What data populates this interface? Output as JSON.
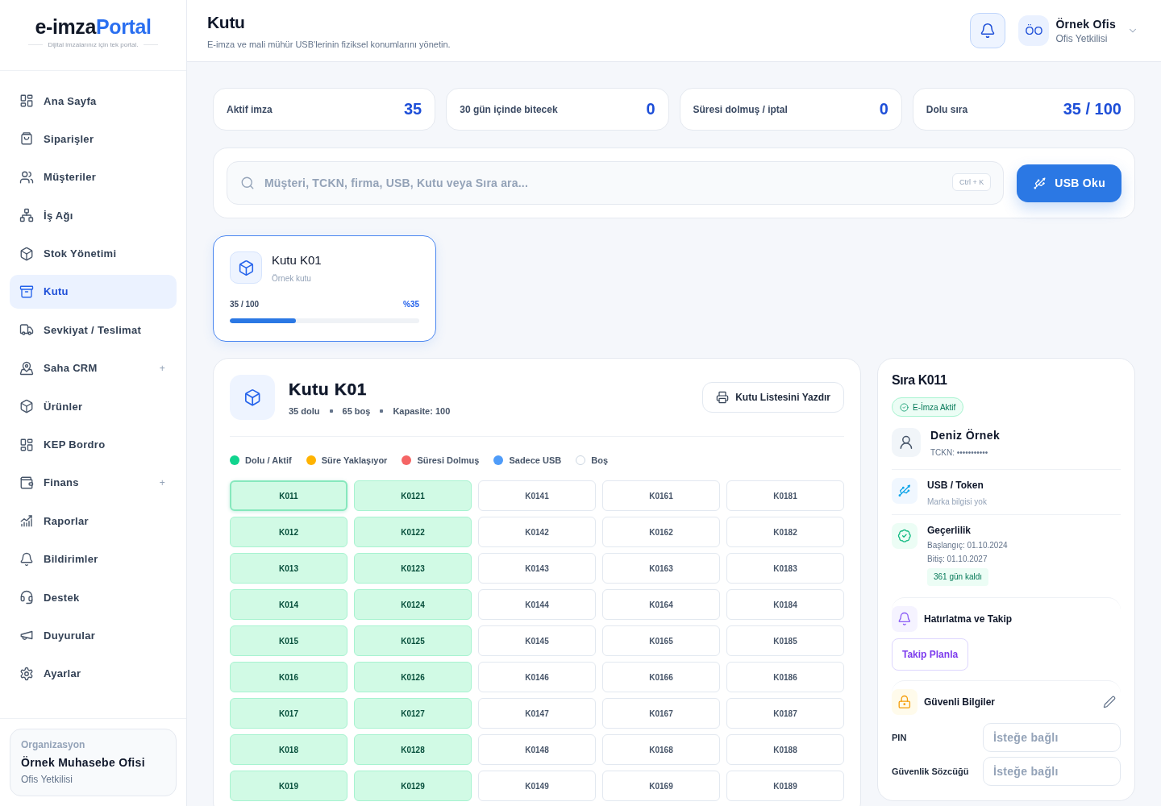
{
  "sidebar": {
    "logo": {
      "text": "e-imza",
      "accent": "Portal",
      "tagline": "Dijital imzalarınız için tek portal."
    },
    "items": [
      {
        "label": "Ana Sayfa",
        "selected": false
      },
      {
        "label": "Siparişler",
        "selected": false
      },
      {
        "label": "Müşteriler",
        "selected": false
      },
      {
        "label": "İş Ağı",
        "selected": false
      },
      {
        "label": "Stok Yönetimi",
        "selected": false
      },
      {
        "label": "Kutu",
        "selected": true
      },
      {
        "label": "Sevkiyat / Teslimat",
        "selected": false
      },
      {
        "label": "Saha CRM",
        "selected": false,
        "toggle": "+"
      },
      {
        "label": "Ürünler",
        "selected": false
      },
      {
        "label": "KEP Bordro",
        "selected": false
      },
      {
        "label": "Finans",
        "selected": false,
        "toggle": "+"
      },
      {
        "label": "Raporlar",
        "selected": false
      },
      {
        "label": "Bildirimler",
        "selected": false
      },
      {
        "label": "Destek",
        "selected": false
      },
      {
        "label": "Duyurular",
        "selected": false
      },
      {
        "label": "Ayarlar",
        "selected": false
      }
    ],
    "organization": {
      "caption": "Organizasyon",
      "name": "Örnek Muhasebe Ofisi",
      "role": "Ofis Yetkilisi"
    }
  },
  "header": {
    "title": "Kutu",
    "subtitle": "E-imza ve mali mühür USB'lerinin fiziksel konumlarını yönetin.",
    "user": {
      "initials": "ÖO",
      "name": "Örnek Ofis",
      "role": "Ofis Yetkilisi"
    }
  },
  "stats": [
    {
      "label": "Aktif imza",
      "value": "35"
    },
    {
      "label": "30 gün içinde bitecek",
      "value": "0"
    },
    {
      "label": "Süresi dolmuş / iptal",
      "value": "0"
    },
    {
      "label": "Dolu sıra",
      "value": "35 / 100"
    }
  ],
  "search": {
    "placeholder": "Müşteri, TCKN, firma, USB, Kutu veya Sıra ara...",
    "shortcut": "Ctrl + K",
    "button": "USB Oku"
  },
  "boxes": [
    {
      "name": "Kutu K01",
      "description": "Örnek kutu",
      "count": "35 / 100",
      "percent": "%35",
      "level": 0.35,
      "selected": true
    }
  ],
  "box_detail": {
    "title": "Kutu K01",
    "meta": [
      "35 dolu",
      "65 boş",
      "Kapasite: 100"
    ],
    "print_button": "Kutu Listesini Yazdır",
    "legend": [
      {
        "label": "Dolu / Aktif",
        "color": "#10d48e"
      },
      {
        "label": "Süre Yaklaşıyor",
        "color": "#ffb300"
      },
      {
        "label": "Süresi Dolmuş",
        "color": "#f56565"
      },
      {
        "label": "Sadece USB",
        "color": "#4f9cf9"
      },
      {
        "label": "Boş",
        "color": "#ffffff"
      }
    ],
    "slots": [
      {
        "label": "K011",
        "kind": "active",
        "selected": true
      },
      {
        "label": "K0121",
        "kind": "active",
        "selected": false
      },
      {
        "label": "K0141",
        "kind": "empty",
        "selected": false
      },
      {
        "label": "K0161",
        "kind": "empty",
        "selected": false
      },
      {
        "label": "K0181",
        "kind": "empty",
        "selected": false
      },
      {
        "label": "K012",
        "kind": "active",
        "selected": false
      },
      {
        "label": "K0122",
        "kind": "active",
        "selected": false
      },
      {
        "label": "K0142",
        "kind": "empty",
        "selected": false
      },
      {
        "label": "K0162",
        "kind": "empty",
        "selected": false
      },
      {
        "label": "K0182",
        "kind": "empty",
        "selected": false
      },
      {
        "label": "K013",
        "kind": "active",
        "selected": false
      },
      {
        "label": "K0123",
        "kind": "active",
        "selected": false
      },
      {
        "label": "K0143",
        "kind": "empty",
        "selected": false
      },
      {
        "label": "K0163",
        "kind": "empty",
        "selected": false
      },
      {
        "label": "K0183",
        "kind": "empty",
        "selected": false
      },
      {
        "label": "K014",
        "kind": "active",
        "selected": false
      },
      {
        "label": "K0124",
        "kind": "active",
        "selected": false
      },
      {
        "label": "K0144",
        "kind": "empty",
        "selected": false
      },
      {
        "label": "K0164",
        "kind": "empty",
        "selected": false
      },
      {
        "label": "K0184",
        "kind": "empty",
        "selected": false
      },
      {
        "label": "K015",
        "kind": "active",
        "selected": false
      },
      {
        "label": "K0125",
        "kind": "active",
        "selected": false
      },
      {
        "label": "K0145",
        "kind": "empty",
        "selected": false
      },
      {
        "label": "K0165",
        "kind": "empty",
        "selected": false
      },
      {
        "label": "K0185",
        "kind": "empty",
        "selected": false
      },
      {
        "label": "K016",
        "kind": "active",
        "selected": false
      },
      {
        "label": "K0126",
        "kind": "active",
        "selected": false
      },
      {
        "label": "K0146",
        "kind": "empty",
        "selected": false
      },
      {
        "label": "K0166",
        "kind": "empty",
        "selected": false
      },
      {
        "label": "K0186",
        "kind": "empty",
        "selected": false
      },
      {
        "label": "K017",
        "kind": "active",
        "selected": false
      },
      {
        "label": "K0127",
        "kind": "active",
        "selected": false
      },
      {
        "label": "K0147",
        "kind": "empty",
        "selected": false
      },
      {
        "label": "K0167",
        "kind": "empty",
        "selected": false
      },
      {
        "label": "K0187",
        "kind": "empty",
        "selected": false
      },
      {
        "label": "K018",
        "kind": "active",
        "selected": false
      },
      {
        "label": "K0128",
        "kind": "active",
        "selected": false
      },
      {
        "label": "K0148",
        "kind": "empty",
        "selected": false
      },
      {
        "label": "K0168",
        "kind": "empty",
        "selected": false
      },
      {
        "label": "K0188",
        "kind": "empty",
        "selected": false
      },
      {
        "label": "K019",
        "kind": "active",
        "selected": false
      },
      {
        "label": "K0129",
        "kind": "active",
        "selected": false
      },
      {
        "label": "K0149",
        "kind": "empty",
        "selected": false
      },
      {
        "label": "K0169",
        "kind": "empty",
        "selected": false
      },
      {
        "label": "K0189",
        "kind": "empty",
        "selected": false
      }
    ]
  },
  "slot_detail": {
    "title": "Sıra K011",
    "badge": "E-İmza Aktif",
    "person": {
      "name": "Deniz Örnek",
      "id_line": "TCKN: •••••••••••"
    },
    "usb": {
      "title": "USB / Token",
      "note": "Marka bilgisi yok"
    },
    "validity": {
      "title": "Geçerlilik",
      "start": "Başlangıç: 01.10.2024",
      "end": "Bitiş: 01.10.2027",
      "remaining": "361 gün kaldı"
    },
    "reminder": {
      "title": "Hatırlatma ve Takip",
      "button": "Takip Planla"
    },
    "secure": {
      "title": "Güvenli Bilgiler",
      "fields": [
        {
          "label": "PIN",
          "placeholder": "İsteğe bağlı"
        },
        {
          "label": "Güvenlik Sözcüğü",
          "placeholder": "İsteğe bağlı"
        }
      ]
    }
  }
}
